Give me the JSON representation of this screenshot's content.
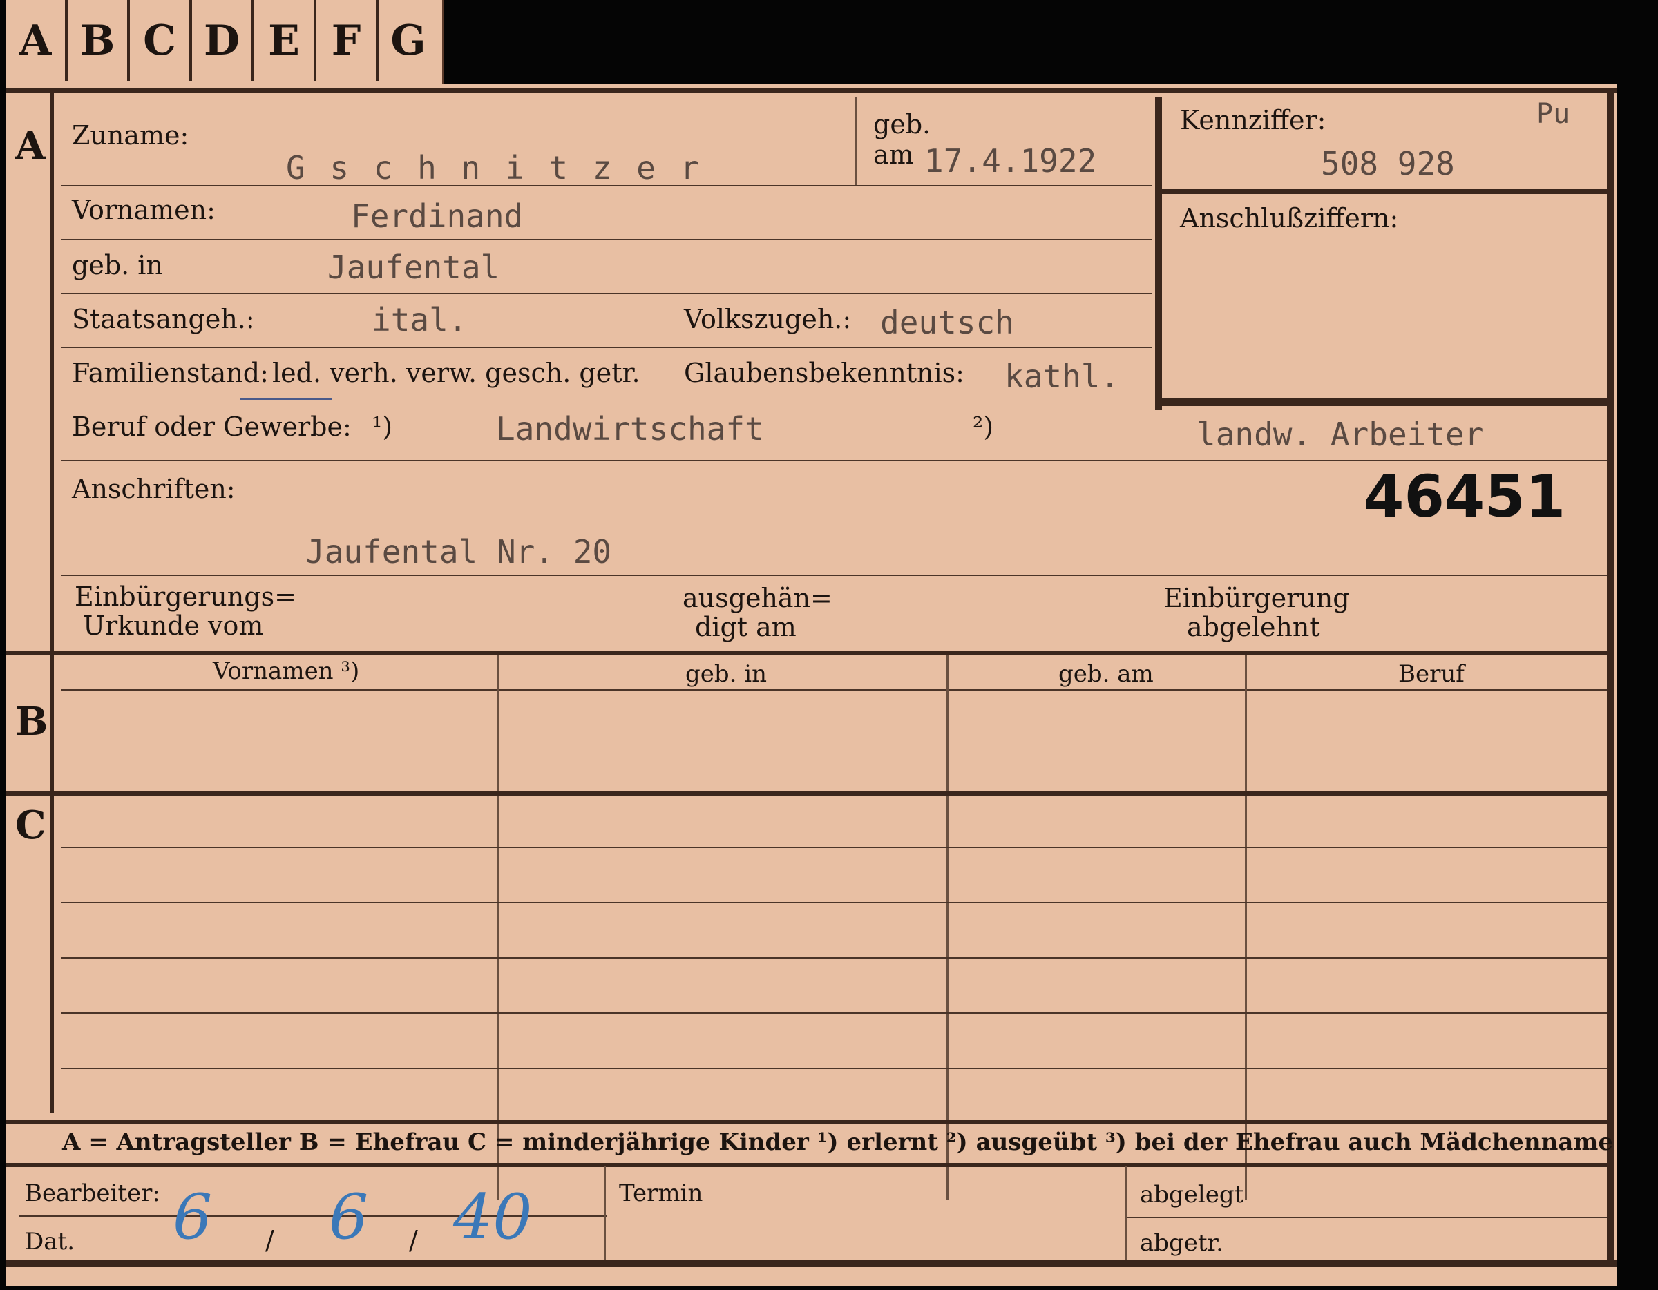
{
  "tabs": [
    "A",
    "B",
    "C",
    "D",
    "E",
    "F",
    "G"
  ],
  "sections": {
    "a": "A",
    "b": "B",
    "c": "C"
  },
  "labels": {
    "zuname": "Zuname:",
    "geb": "geb.",
    "am": "am",
    "kennziffer": "Kennziffer:",
    "anschluss": "Anschlußziffern:",
    "vornamen": "Vornamen:",
    "geb_in": "geb. in",
    "staatsangeh": "Staatsangeh.:",
    "volkszugeh": "Volkszugeh.:",
    "familienstand": "Familienstand:",
    "familienstand_options": "led. verh. verw. gesch. getr.",
    "glaubens": "Glaubensbekenntnis:",
    "beruf": "Beruf oder Gewerbe:",
    "fn1": "¹)",
    "fn2": "²)",
    "anschriften": "Anschriften:",
    "einb1": "Einbürgerungs=",
    "einb2": "Urkunde vom",
    "ausg1": "ausgehän=",
    "ausg2": "digt am",
    "abgl1": "Einbürgerung",
    "abgl2": "abgelehnt",
    "bearbeiter": "Bearbeiter:",
    "dat": "Dat.",
    "termin": "Termin",
    "abgelegt": "abgelegt",
    "abgetr": "abgetr."
  },
  "table_headers": [
    "Vornamen ³)",
    "geb. in",
    "geb. am",
    "Beruf"
  ],
  "legend": "A = Antragsteller   B = Ehefrau   C = minderjährige Kinder   ¹) erlernt   ²) ausgeübt   ³) bei der Ehefrau auch Mädchenname",
  "values": {
    "zuname": "G s c h n i t z e r",
    "geb_am": "17.4.1922",
    "pu": "Pu",
    "kennziffer": "508 928",
    "vornamen": "Ferdinand",
    "geb_in": "Jaufental",
    "staatsangeh": "ital.",
    "volkszugeh": "deutsch",
    "glaube": "kathl.",
    "beruf_erlernt": "Landwirtschaft",
    "beruf_ausgeuebt": "landw. Arbeiter",
    "number": "46451",
    "anschrift": "Jaufental Nr. 20",
    "date_d": "6",
    "date_m": "6",
    "date_y": "40",
    "sep": "/"
  }
}
